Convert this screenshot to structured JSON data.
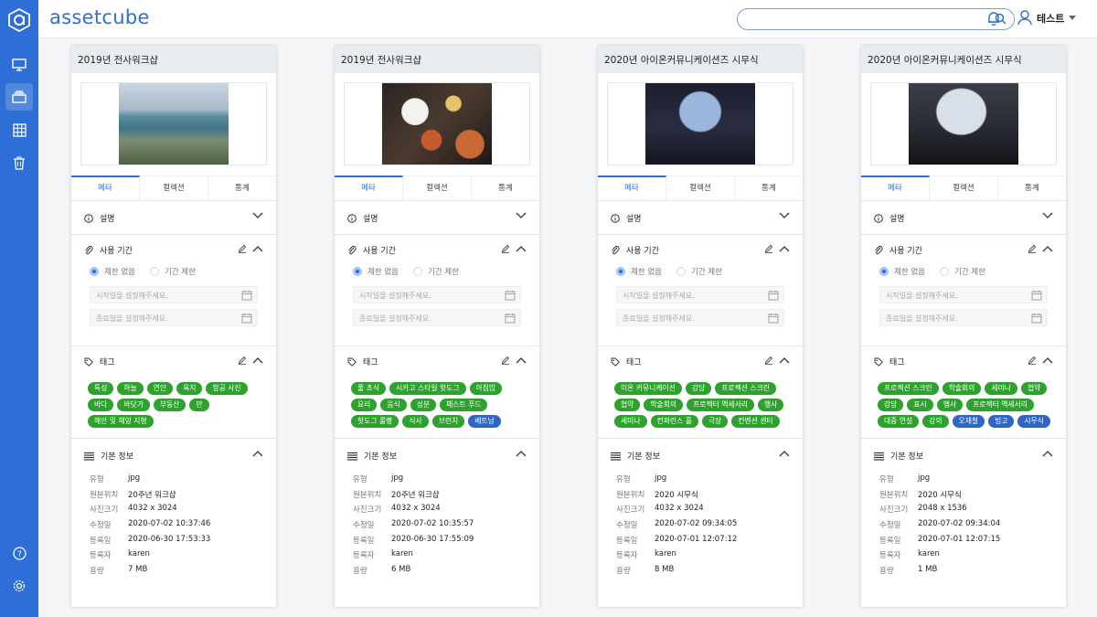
{
  "brand": "assetcube",
  "header": {
    "search_placeholder": "",
    "user_name": "테스트"
  },
  "sidebar": {
    "items": [
      {
        "icon": "monitor-icon"
      },
      {
        "icon": "stack-icon",
        "active": true
      },
      {
        "icon": "grid-icon"
      },
      {
        "icon": "trash-icon"
      },
      {
        "icon": "help-icon"
      },
      {
        "icon": "gear-icon"
      }
    ]
  },
  "labels": {
    "tab_meta": "메타",
    "tab_collection": "컬렉션",
    "tab_stats": "통계",
    "description": "설명",
    "usage_period": "사용 기간",
    "no_limit": "제한 없음",
    "period_limit": "기간 제한",
    "start_placeholder": "시작일을 설정해주세요.",
    "end_placeholder": "종료일을 설정해주세요.",
    "tags": "태그",
    "basic_info": "기본 정보",
    "type": "유형",
    "source": "원본위치",
    "size": "사진크기",
    "modified": "수정일",
    "registered": "등록일",
    "registrant": "등록자",
    "volume": "용량"
  },
  "cards": [
    {
      "title": "2019년 전사워크샵",
      "tags": [
        {
          "t": "특성",
          "c": "green"
        },
        {
          "t": "하늘",
          "c": "green"
        },
        {
          "t": "연안",
          "c": "green"
        },
        {
          "t": "육지",
          "c": "green"
        },
        {
          "t": "항공 사진",
          "c": "green"
        },
        {
          "t": "바다",
          "c": "green"
        },
        {
          "t": "바닷가",
          "c": "green"
        },
        {
          "t": "부동산",
          "c": "green"
        },
        {
          "t": "만",
          "c": "green"
        },
        {
          "t": "해안 및 해양 지형",
          "c": "green"
        }
      ],
      "info": {
        "type": "jpg",
        "source": "20주년 워크샵",
        "size": "4032 x 3024",
        "modified": "2020-07-02 10:37:46",
        "registered": "2020-06-30 17:53:33",
        "registrant": "karen",
        "volume": "7 MB"
      }
    },
    {
      "title": "2019년 전사워크샵",
      "tags": [
        {
          "t": "풀 조식",
          "c": "green"
        },
        {
          "t": "시카고 스타일 핫도그",
          "c": "green"
        },
        {
          "t": "아침밥",
          "c": "green"
        },
        {
          "t": "요리",
          "c": "green"
        },
        {
          "t": "음식",
          "c": "green"
        },
        {
          "t": "성분",
          "c": "green"
        },
        {
          "t": "패스트 푸드",
          "c": "green"
        },
        {
          "t": "핫도그 롤빵",
          "c": "green"
        },
        {
          "t": "식사",
          "c": "green"
        },
        {
          "t": "브런치",
          "c": "green"
        },
        {
          "t": "베트남",
          "c": "blue"
        }
      ],
      "info": {
        "type": "jpg",
        "source": "20주년 워크샵",
        "size": "4032 x 3024",
        "modified": "2020-07-02 10:35:57",
        "registered": "2020-06-30 17:55:09",
        "registrant": "karen",
        "volume": "6 MB"
      }
    },
    {
      "title": "2020년 아이온커뮤니케이션즈 시무식",
      "tags": [
        {
          "t": "이온 커뮤니케이션",
          "c": "green"
        },
        {
          "t": "강당",
          "c": "green"
        },
        {
          "t": "프로젝션 스크린",
          "c": "green"
        },
        {
          "t": "협약",
          "c": "green"
        },
        {
          "t": "학술회의",
          "c": "green"
        },
        {
          "t": "프로젝터 액세서리",
          "c": "green"
        },
        {
          "t": "행사",
          "c": "green"
        },
        {
          "t": "세미나",
          "c": "green"
        },
        {
          "t": "컨퍼런스 홀",
          "c": "green"
        },
        {
          "t": "극장",
          "c": "green"
        },
        {
          "t": "컨벤션 센터",
          "c": "green"
        }
      ],
      "info": {
        "type": "jpg",
        "source": "2020 시무식",
        "size": "4032 x 3024",
        "modified": "2020-07-02 09:34:05",
        "registered": "2020-07-01 12:07:12",
        "registrant": "karen",
        "volume": "8 MB"
      }
    },
    {
      "title": "2020년 아이온커뮤니케이션즈 시무식",
      "tags": [
        {
          "t": "프로젝션 스크린",
          "c": "green"
        },
        {
          "t": "학술회의",
          "c": "green"
        },
        {
          "t": "세미나",
          "c": "green"
        },
        {
          "t": "협약",
          "c": "green"
        },
        {
          "t": "강당",
          "c": "green"
        },
        {
          "t": "표시",
          "c": "green"
        },
        {
          "t": "행사",
          "c": "green"
        },
        {
          "t": "프로젝터 액세서리",
          "c": "green"
        },
        {
          "t": "대중 연설",
          "c": "green"
        },
        {
          "t": "강의",
          "c": "green"
        },
        {
          "t": "오재철",
          "c": "blue"
        },
        {
          "t": "빙고",
          "c": "blue"
        },
        {
          "t": "시무식",
          "c": "blue"
        }
      ],
      "info": {
        "type": "jpg",
        "source": "2020 시무식",
        "size": "2048 x 1536",
        "modified": "2020-07-02 09:34:04",
        "registered": "2020-07-01 12:07:15",
        "registrant": "karen",
        "volume": "1 MB"
      }
    }
  ]
}
